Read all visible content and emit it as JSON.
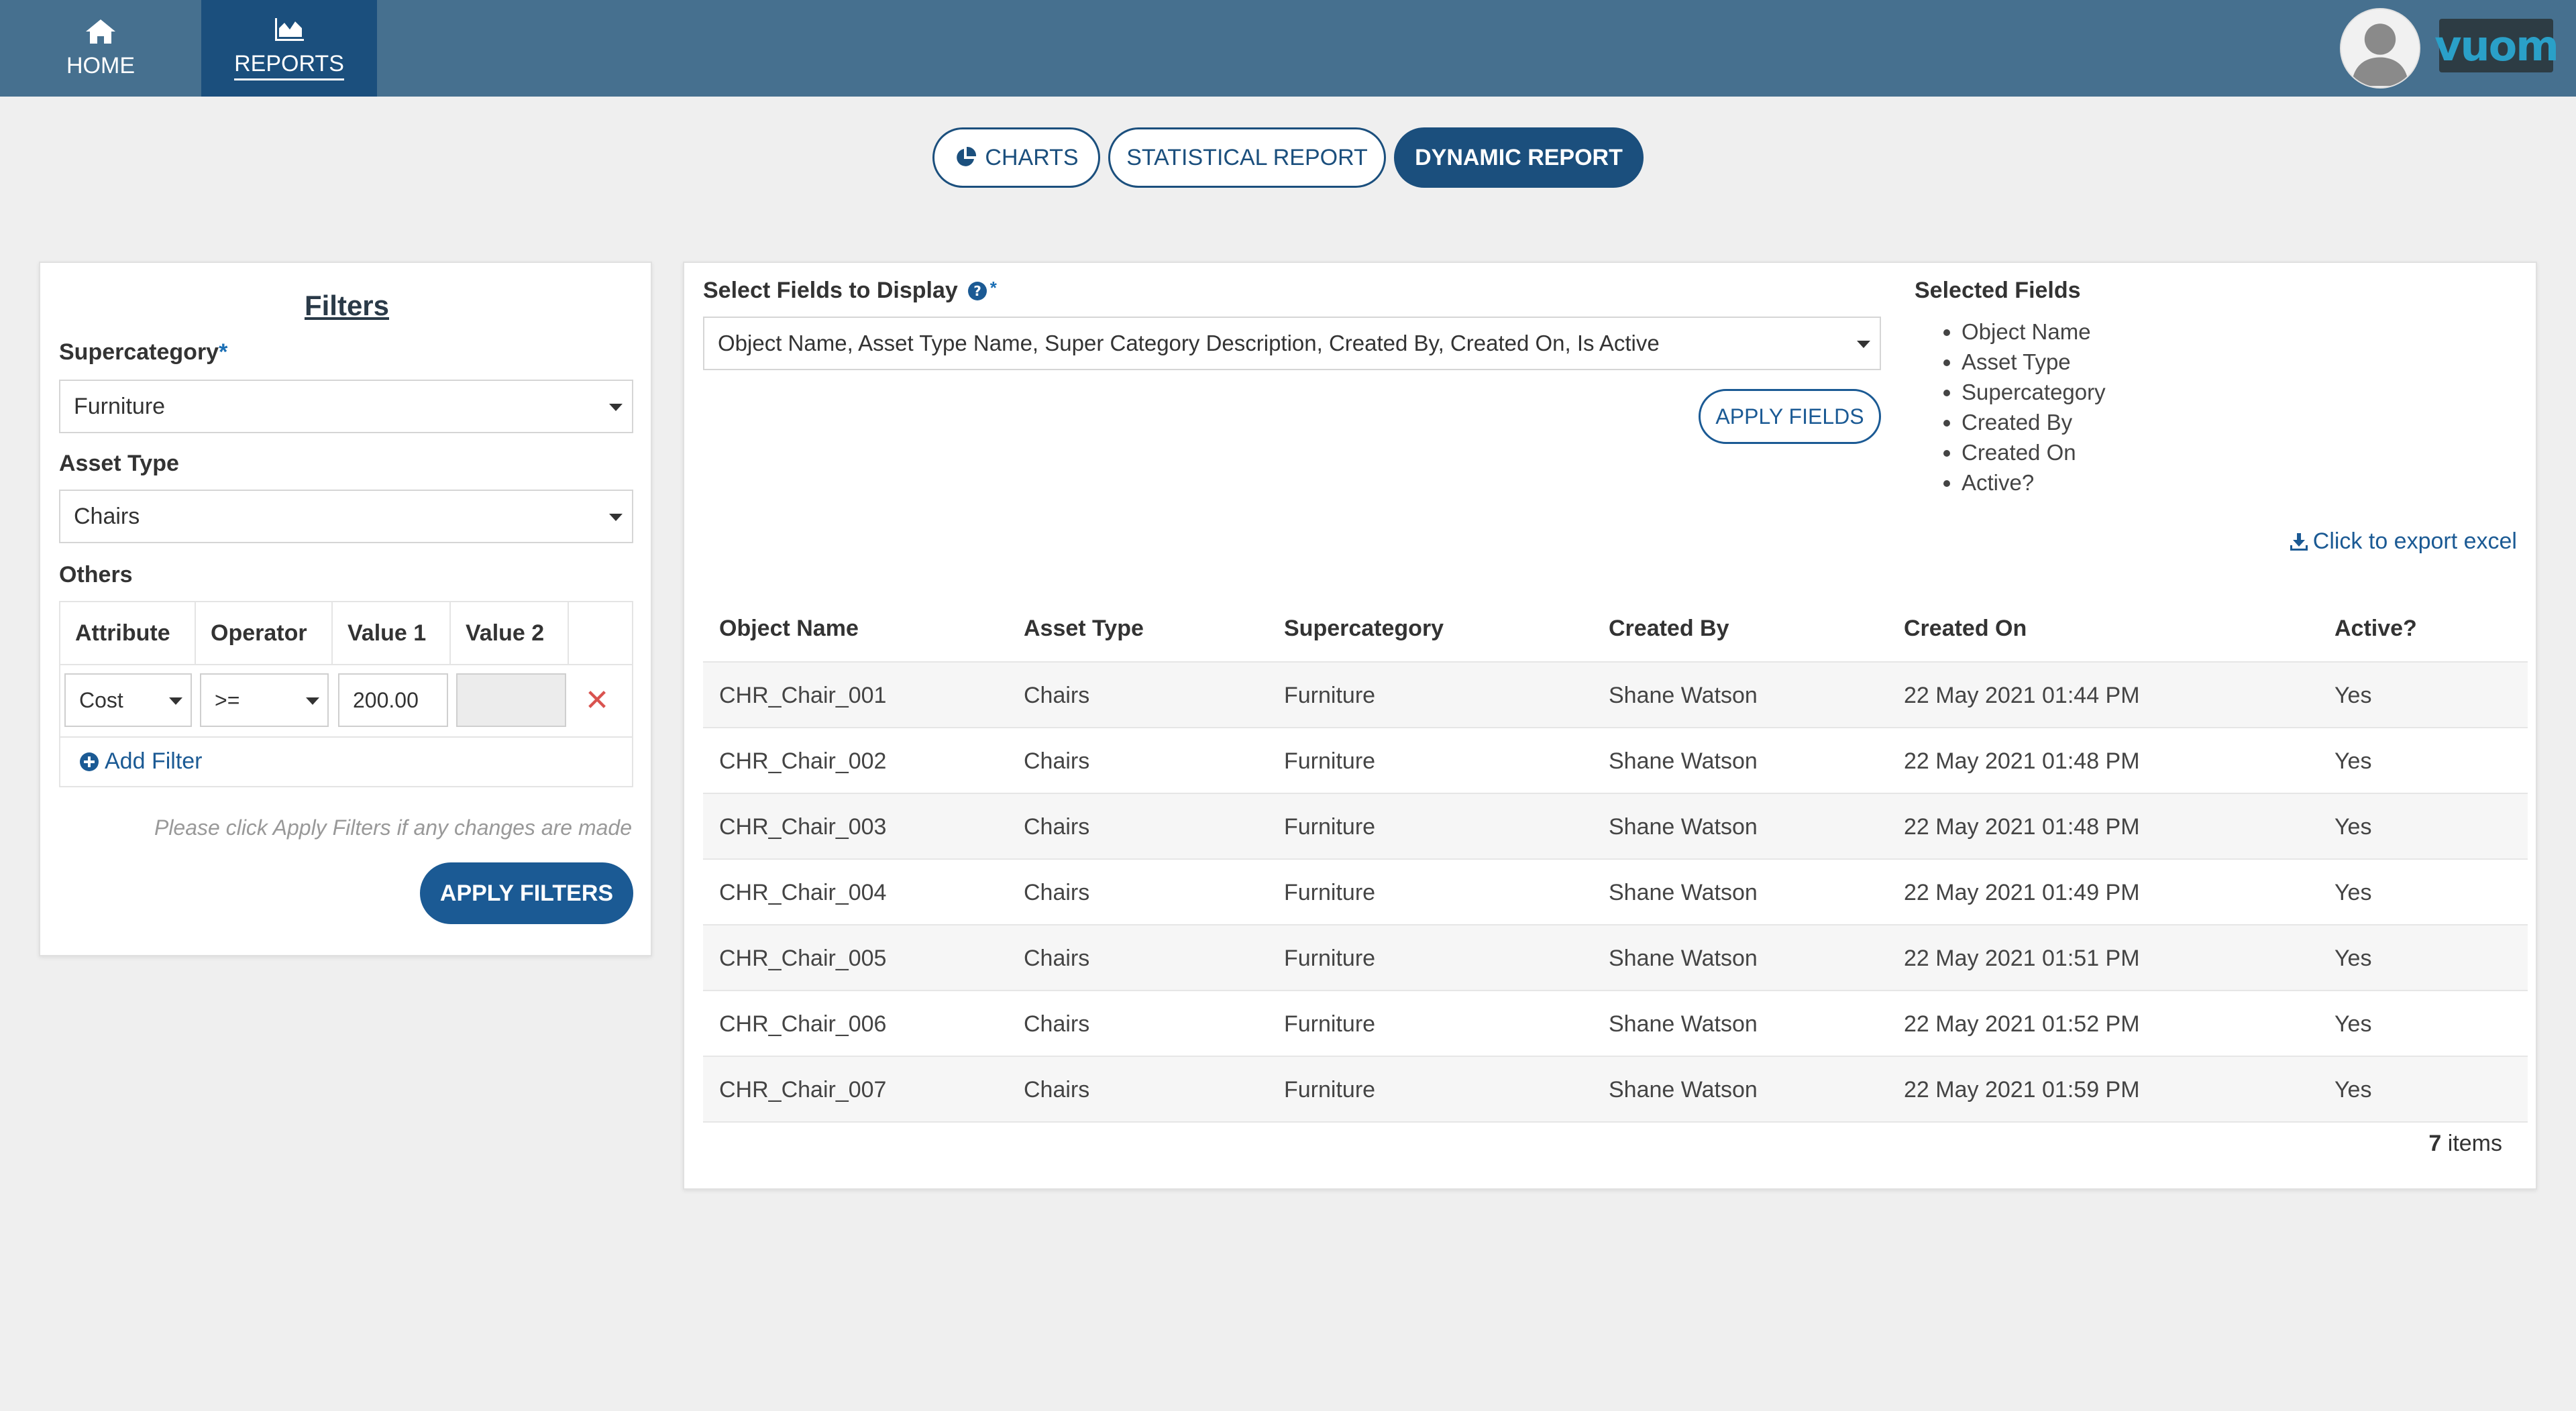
{
  "nav": {
    "home_label": "HOME",
    "reports_label": "REPORTS",
    "logo_text": "vuom"
  },
  "tabs": {
    "charts": "CHARTS",
    "statistical": "STATISTICAL REPORT",
    "dynamic": "DYNAMIC REPORT"
  },
  "filters": {
    "title": "Filters",
    "supercategory_label": "Supercategory",
    "required_mark": "*",
    "supercategory_value": "Furniture",
    "asset_type_label": "Asset Type",
    "asset_type_value": "Chairs",
    "others_label": "Others",
    "others_headers": [
      "Attribute",
      "Operator",
      "Value 1",
      "Value 2"
    ],
    "attribute_value": "Cost",
    "operator_value": ">=",
    "value1": "200.00",
    "value2": "",
    "add_filter": "Add Filter",
    "hint": "Please click Apply Filters if any changes are made",
    "apply_button": "APPLY FILTERS"
  },
  "fields": {
    "label": "Select Fields to Display",
    "required_mark": "*",
    "selected_value": "Object Name, Asset Type Name, Super Category Description, Created By, Created On, Is Active",
    "apply_button": "APPLY FIELDS",
    "selected_title": "Selected Fields",
    "selected_list": [
      "Object Name",
      "Asset Type",
      "Supercategory",
      "Created By",
      "Created On",
      "Active?"
    ]
  },
  "export_label": "Click to export excel",
  "grid": {
    "headers": [
      "Object Name",
      "Asset Type",
      "Supercategory",
      "Created By",
      "Created On",
      "Active?"
    ],
    "rows": [
      [
        "CHR_Chair_001",
        "Chairs",
        "Furniture",
        "Shane Watson",
        "22 May 2021 01:44 PM",
        "Yes"
      ],
      [
        "CHR_Chair_002",
        "Chairs",
        "Furniture",
        "Shane Watson",
        "22 May 2021 01:48 PM",
        "Yes"
      ],
      [
        "CHR_Chair_003",
        "Chairs",
        "Furniture",
        "Shane Watson",
        "22 May 2021 01:48 PM",
        "Yes"
      ],
      [
        "CHR_Chair_004",
        "Chairs",
        "Furniture",
        "Shane Watson",
        "22 May 2021 01:49 PM",
        "Yes"
      ],
      [
        "CHR_Chair_005",
        "Chairs",
        "Furniture",
        "Shane Watson",
        "22 May 2021 01:51 PM",
        "Yes"
      ],
      [
        "CHR_Chair_006",
        "Chairs",
        "Furniture",
        "Shane Watson",
        "22 May 2021 01:52 PM",
        "Yes"
      ],
      [
        "CHR_Chair_007",
        "Chairs",
        "Furniture",
        "Shane Watson",
        "22 May 2021 01:59 PM",
        "Yes"
      ]
    ],
    "count_number": "7",
    "count_suffix": " items"
  },
  "colors": {
    "topbar": "#46708f",
    "active_nav": "#1b4f7d",
    "primary": "#1b5a94",
    "danger": "#d9534f"
  }
}
